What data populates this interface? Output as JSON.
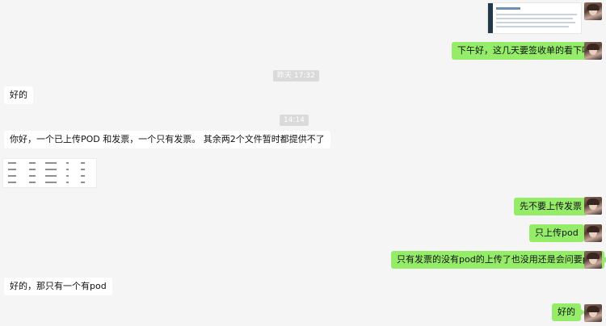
{
  "conversation": {
    "timestamps": [
      "昨天 17:32",
      "14:14"
    ],
    "messages_right": [
      "下午好，这几天要签收单的看下哈",
      "先不要上传发票",
      "只上传pod",
      "只有发票的没有pod的上传了也没用还是会问要pod",
      "好的"
    ],
    "messages_left": [
      "好的",
      "你好，一个已上传POD 和发票，一个只有发票。 其余两2个文件暂时都提供不了",
      "好的，那只有一个有pod"
    ]
  },
  "colors": {
    "sent_bubble": "#95ec69",
    "received_bubble": "#ffffff",
    "background": "#f5f5f5"
  }
}
